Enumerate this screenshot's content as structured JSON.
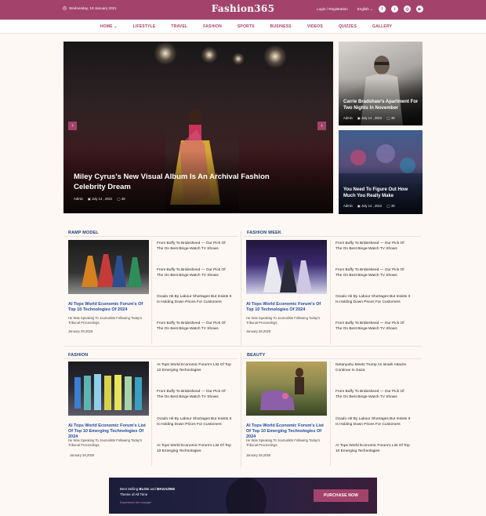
{
  "topbar": {
    "date": "Wednesday, 19 January 2021",
    "logo": "Fashion365",
    "auth": "Login / Registration",
    "language": "English",
    "social_icons": [
      "facebook-icon",
      "twitter-icon",
      "instagram-icon",
      "youtube-icon"
    ]
  },
  "nav": [
    "HOME",
    "LIFESTYLE",
    "TRAVEL",
    "FASHION",
    "SPORTS",
    "BUSINESS",
    "VIDEOS",
    "QUIZZES",
    "GALLERY"
  ],
  "hero": {
    "title": "Miley Cyrus's New Visual Album Is An Archival Fashion Celebrity Dream",
    "author": "Admin",
    "date": "July 14 , 2022",
    "comments": "39"
  },
  "side_posts": [
    {
      "title": "Carrie Bradshaw's Apartment For Two Nights In November",
      "author": "Admin",
      "date": "July 14 , 2022",
      "comments": "39"
    },
    {
      "title": "You Need To Figure Out How Much You Really Make",
      "author": "Admin",
      "date": "July 14 , 2022",
      "comments": "39"
    }
  ],
  "sections": [
    {
      "name": "RAMP MODEL",
      "feature_title": "AI Tops World Economic Forum's Of Top 10 Technologies Of 2024",
      "feature_desc": "He Was Speaking To Journalists Following Today's Tribunal Proceedings.",
      "feature_date": "January 28,2025",
      "items": [
        "From Buffy To Bridesheed — Our Pick Of The On Best Binge-Watch TV Shows",
        "From Buffy To Bridesheed — Our Pick Of The On Best Binge-Watch TV Shows",
        "Ocado Hit By Labour Shortages But Insists It Is Holding Down Prices For Customers",
        "From Buffy To Bridesheed — Our Pick Of The On Best Binge-Watch TV Shows"
      ]
    },
    {
      "name": "FASHION WEEK",
      "feature_title": "AI Tops World Economic Forum's Of Top 10 Technologies Of 2024",
      "feature_desc": "He Was Speaking To Journalists Following Today's Tribunal Proceedings.",
      "feature_date": "January 28,2025",
      "items": [
        "From Buffy To Bridesheed — Our Pick Of The On Best Binge-Watch TV Shows",
        "From Buffy To Bridesheed — Our Pick Of The On Best Binge-Watch TV Shows",
        "Ocado Hit By Labour Shortages But Insists It Is Holding Down Prices For Customers",
        "From Buffy To Bridesheed — Our Pick Of The On Best Binge-Watch TV Shows"
      ]
    },
    {
      "name": "FASHION",
      "feature_title": "AI Tops World Economic Forum's List Of Top 10 Emerging Technologies Of 2024",
      "feature_desc": "He Was Speaking To Journalists Following Today's Tribunal Proceedings.",
      "feature_date": "January 28,2025",
      "items": [
        "AI Tops World Economic Forum's List Of Top 10 Emerging Technologies",
        "From Buffy To Bridesheed — Our Pick Of The On Best Binge-Watch TV Shows",
        "Ocado Hit By Labour Shortages But Insists It Is Holding Down Prices For Customers",
        "AI Tops World Economic Forum's List Of Top 10 Emerging Technologies"
      ]
    },
    {
      "name": "BEAUTY",
      "feature_title": "AI Tops World Economic Forum's List Of Top 10 Emerging Technologies Of 2024",
      "feature_desc": "He Was Speaking To Journalists Following Today's Tribunal Proceedings.",
      "feature_date": "January 28,2025",
      "items": [
        "Netanyahu Meets Trump As Israeli Attacks Continue In Gaza",
        "From Buffy To Bridesheed — Our Pick Of The On Best Binge-Watch TV Shows",
        "Ocado Hit By Labour Shortages But Insists It Is Holding Down Prices For Customers",
        "AI Tops World Economic Forum's List Of Top 10 Emerging Technologies"
      ]
    }
  ],
  "banner": {
    "line1_prefix": "Best Selling ",
    "line1_blog": "BLOG",
    "line1_and": " and ",
    "line1_magazine": "MAGAZINE",
    "line2": "Theme of All Time",
    "sub": "Experience the change!",
    "button": "PURCHASE NOW"
  },
  "colors": {
    "brand": "#a3436b",
    "link": "#1f4aa0",
    "section_heading": "#1f3b7a"
  }
}
